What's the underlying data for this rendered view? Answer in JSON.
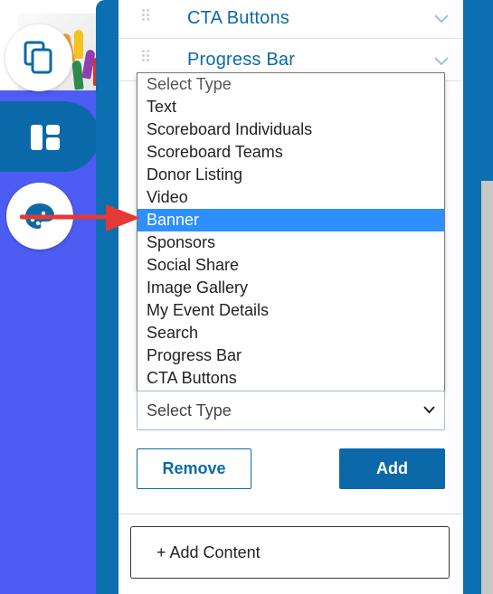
{
  "colors": {
    "accent": "#0c69a9",
    "left_bg": "#4d5cf2",
    "selected": "#2e8fff",
    "arrow": "#e53935"
  },
  "rows": [
    {
      "label": "CTA Buttons"
    },
    {
      "label": "Progress Bar"
    }
  ],
  "listbox": {
    "options": [
      "Select Type",
      "Text",
      "Scoreboard Individuals",
      "Scoreboard Teams",
      "Donor Listing",
      "Video",
      "Banner",
      "Sponsors",
      "Social Share",
      "Image Gallery",
      "My Event Details",
      "Search",
      "Progress Bar",
      "CTA Buttons"
    ],
    "selected": "Banner"
  },
  "select": {
    "value": "Select Type"
  },
  "buttons": {
    "remove": "Remove",
    "add": "Add",
    "add_content": "+ Add Content"
  },
  "icons": {
    "copy": "copy-icon",
    "dashboard": "dashboard-icon",
    "palette": "palette-icon",
    "drag": "drag-handle-icon",
    "chevron": "chevron-down-icon"
  }
}
